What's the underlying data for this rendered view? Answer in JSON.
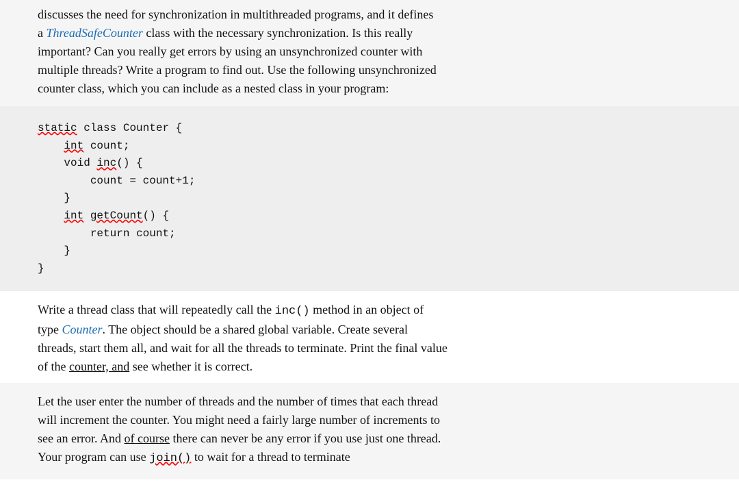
{
  "intro_text": {
    "line1": "discusses the need for synchronization in multithreaded programs, and it defines",
    "line2_pre": "a ",
    "line2_link": "ThreadSafeCounter",
    "line2_post": " class with the necessary synchronization. Is this really",
    "line3": "important? Can you really get errors by using an unsynchronized counter with",
    "line4": "multiple threads? Write a program to find out. Use the following unsynchronized",
    "line5": "counter class, which you can include as a nested class in your program:"
  },
  "code": {
    "lines": [
      "static class Counter {",
      "    int count;",
      "    void inc() {",
      "        count = count+1;",
      "    }",
      "    int getCount() {",
      "        return count;",
      "    }",
      "}"
    ]
  },
  "paragraph2": {
    "pre": "Write a thread class that will repeatedly call the ",
    "inline1": "inc()",
    "mid": " method in an object of",
    "line2_pre": "type ",
    "line2_link": "Counter",
    "line2_post": ". The object should be a shared global variable. Create several",
    "line3": "threads, start them all, and wait for all the threads to terminate. Print the final value",
    "line4_pre": "of the ",
    "line4_underline": "counter, and",
    "line4_post": " see whether it is correct."
  },
  "paragraph3": {
    "line1": "Let the user enter the number of threads and the number of times that each thread",
    "line2": "will increment the counter. You might need a fairly large number of increments to",
    "line3_pre": "see an error. And ",
    "line3_underline": "of course",
    "line3_post": " there can never be any error if you use just one thread.",
    "line4_pre": "Your program can use ",
    "line4_inline": "join()",
    "line4_post": " to wait for a thread to terminate"
  },
  "labels": {
    "int": "int",
    "void": "void",
    "static": "static",
    "class": "class",
    "return": "return",
    "count": "count",
    "counter_name": "Counter"
  }
}
